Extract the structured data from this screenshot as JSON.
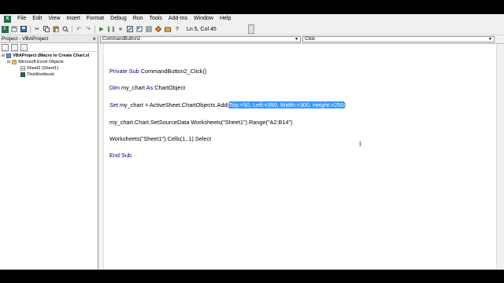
{
  "menubar": {
    "items": [
      "File",
      "Edit",
      "View",
      "Insert",
      "Format",
      "Debug",
      "Run",
      "Tools",
      "Add-Ins",
      "Window",
      "Help"
    ]
  },
  "toolbar": {
    "icons": [
      "excel-icon",
      "insert-icon",
      "save-icon",
      "cut-icon",
      "copy-icon",
      "paste-icon",
      "find-icon",
      "undo-icon",
      "redo-icon",
      "run-icon",
      "break-icon",
      "reset-icon",
      "design-mode-icon",
      "project-explorer-icon",
      "properties-icon",
      "object-browser-icon",
      "toolbox-icon",
      "help-icon"
    ],
    "status": "Ln 5, Col 45"
  },
  "project": {
    "title": "Project - VBAProject",
    "close": "×",
    "tree": [
      {
        "label": "VBAProject (Macro to Create Chart.xl",
        "icon": "vba-project-icon"
      },
      {
        "label": "Microsoft Excel Objects",
        "icon": "folder-icon"
      },
      {
        "label": "Sheet2 (Sheet1)",
        "icon": "sheet-icon"
      },
      {
        "label": "ThisWorkbook",
        "icon": "workbook-icon"
      }
    ]
  },
  "editor": {
    "object_combo": "CommandButton2",
    "proc_combo": "Click",
    "lines": {
      "l1_kw": "Private Sub",
      "l1_rest": " CommandButton2_Click()",
      "l2_kw": "Dim",
      "l2_mid": " my_chart ",
      "l2_kw2": "As",
      "l2_rest": " ChartObject",
      "l3_kw": "Set",
      "l3_rest": " my_chart = ActiveSheet.ChartObjects.Add(",
      "l3_sel": "Top:=50, Left:=350, Width:=300, Height:=250",
      "l3_end": ")",
      "l4": "my_chart.Chart.SetSourceData Worksheets(\"Sheet1\").Range(\"A2:B14\")",
      "l5": "Worksheets(\"Sheet1\").Cells(1, 1).Select",
      "l6_kw": "End Sub"
    },
    "cursor": "I"
  },
  "colors": {
    "keyword": "#00008b",
    "selection": "#3399ff"
  }
}
